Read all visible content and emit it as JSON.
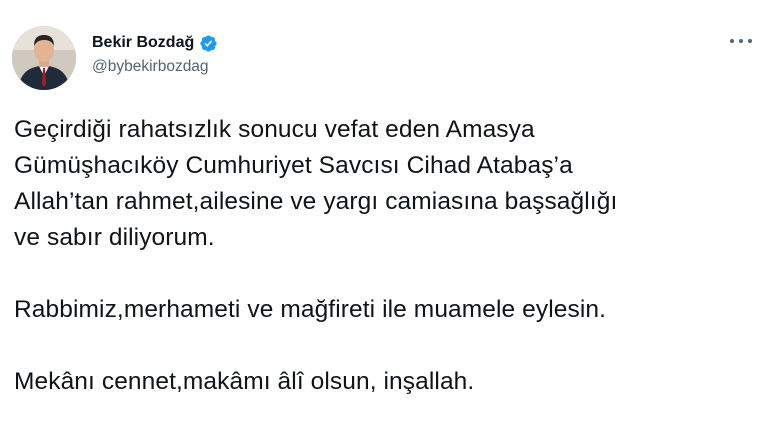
{
  "author": {
    "display_name": "Bekir Bozdağ",
    "handle": "@bybekirbozdag",
    "avatar_icon": "profile-photo",
    "verified_icon": "verified-badge-icon",
    "verified_color": "#1d9bf0"
  },
  "more_icon": "more-dots-icon",
  "tweet": {
    "lines": [
      "Geçirdiği rahatsızlık sonucu vefat eden Amasya",
      "Gümüşhacıköy Cumhuriyet Savcısı Cihad Atabaş’a",
      "Allah’tan rahmet,ailesine ve yargı camiasına başsağlığı",
      "ve sabır diliyorum.",
      "Rabbimiz,merhameti ve mağfireti ile muamele eylesin.",
      "Mekânı cennet,makâmı âlî olsun, inşallah."
    ]
  },
  "colors": {
    "text": "#0f1419",
    "secondary": "#536471"
  }
}
